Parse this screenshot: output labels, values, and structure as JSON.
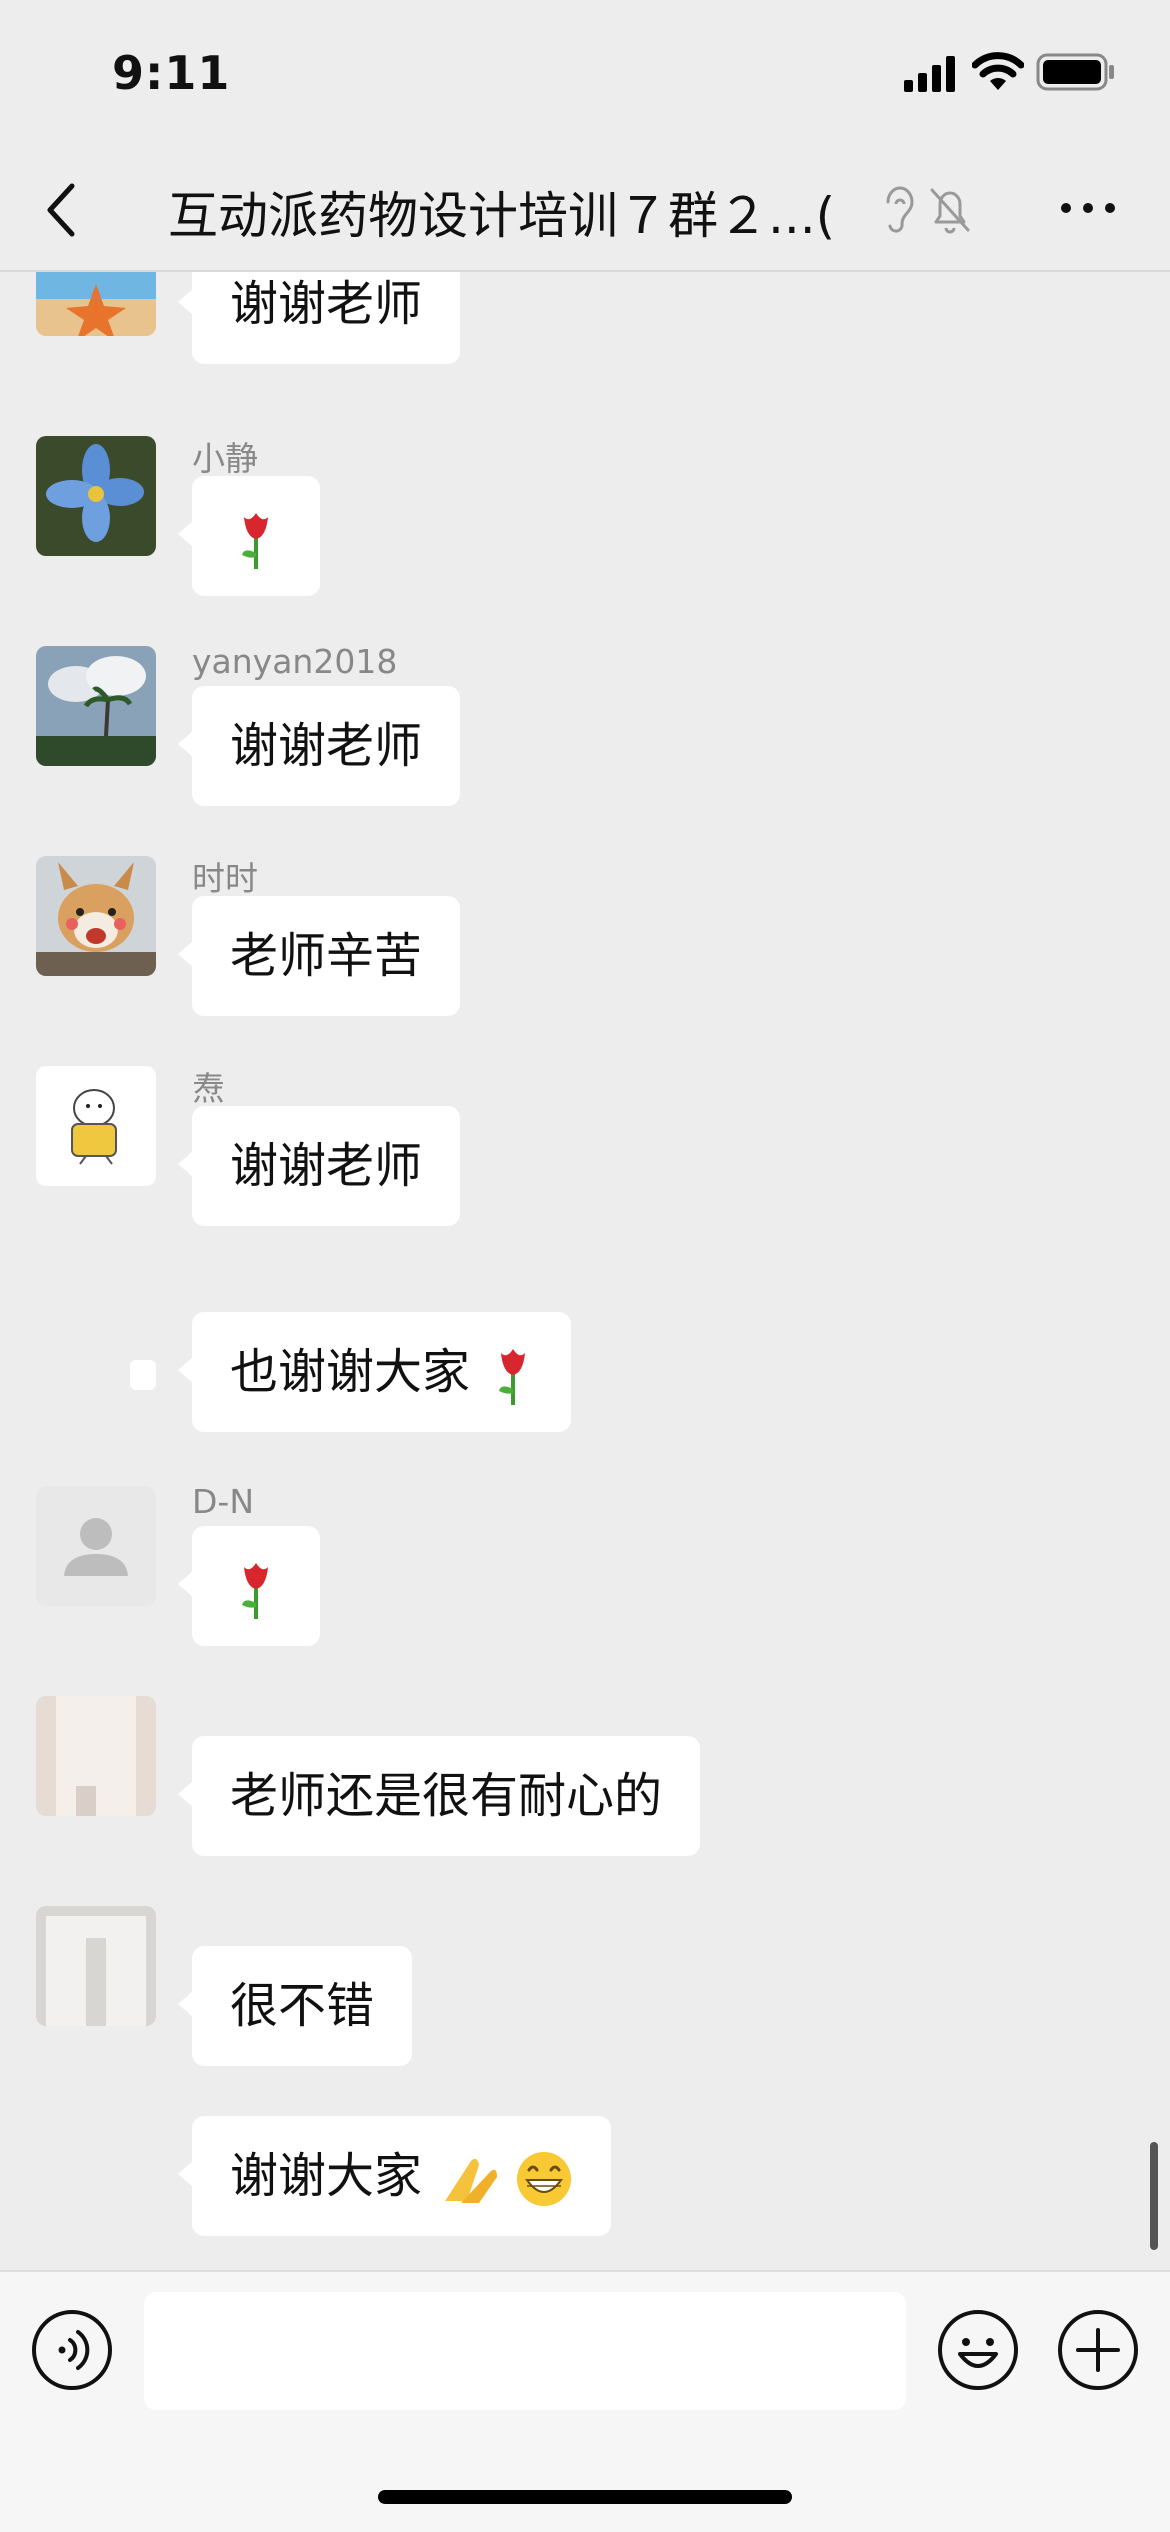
{
  "status_bar": {
    "time": "9:11"
  },
  "nav": {
    "title": "互动派药物设计培训７群２...(　 )"
  },
  "messages": [
    {
      "sender": "",
      "text": "谢谢老师",
      "rose": false
    },
    {
      "sender": "小静",
      "text": "",
      "rose": true
    },
    {
      "sender": "yanyan2018",
      "text": "谢谢老师",
      "rose": false
    },
    {
      "sender": "时时",
      "text": "老师辛苦",
      "rose": false
    },
    {
      "sender": "焘",
      "text": "谢谢老师",
      "rose": false
    },
    {
      "sender": "",
      "text": "也谢谢大家",
      "rose": true
    },
    {
      "sender": "D-N",
      "text": "",
      "rose": true
    },
    {
      "sender": "",
      "text": "老师还是很有耐心的",
      "rose": false
    },
    {
      "sender": "",
      "text": "很不错",
      "rose": false
    },
    {
      "sender": "",
      "text": "谢谢大家",
      "rose": false
    }
  ],
  "input": {
    "placeholder": ""
  },
  "colors": {
    "background": "#ededed",
    "bubble": "#ffffff",
    "rose": "#d7262e"
  }
}
